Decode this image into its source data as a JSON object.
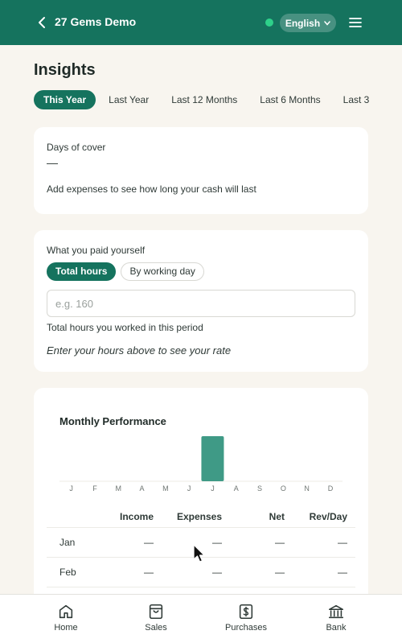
{
  "header": {
    "title": "27 Gems Demo",
    "language": "English"
  },
  "page": {
    "title": "Insights"
  },
  "tabs": [
    {
      "label": "This Year",
      "active": true
    },
    {
      "label": "Last Year",
      "active": false
    },
    {
      "label": "Last 12 Months",
      "active": false
    },
    {
      "label": "Last 6 Months",
      "active": false
    },
    {
      "label": "Last 3",
      "active": false
    }
  ],
  "days_of_cover": {
    "label": "Days of cover",
    "value": "—",
    "hint": "Add expenses to see how long your cash will last"
  },
  "paid_yourself": {
    "label": "What you paid yourself",
    "toggle": [
      "Total hours",
      "By working day"
    ],
    "input_placeholder": "e.g. 160",
    "input_hint": "Total hours you worked in this period",
    "prompt": "Enter your hours above to see your rate"
  },
  "monthly": {
    "title": "Monthly Performance",
    "columns": [
      "",
      "Income",
      "Expenses",
      "Net",
      "Rev/Day"
    ],
    "rows": [
      [
        "Jan",
        "—",
        "—",
        "—",
        "—"
      ],
      [
        "Feb",
        "—",
        "—",
        "—",
        "—"
      ]
    ]
  },
  "chart_data": {
    "type": "bar",
    "categories": [
      "J",
      "F",
      "M",
      "A",
      "M",
      "J",
      "J",
      "A",
      "S",
      "O",
      "N",
      "D"
    ],
    "values": [
      0,
      0,
      0,
      0,
      0,
      0,
      1,
      0,
      0,
      0,
      0,
      0
    ],
    "title": "Monthly Performance",
    "bar_color": "#3f9a86",
    "ylim": [
      0,
      1
    ]
  },
  "nav": [
    {
      "label": "Home",
      "icon": "home-icon"
    },
    {
      "label": "Sales",
      "icon": "bag-icon"
    },
    {
      "label": "Purchases",
      "icon": "receipt-dollar-icon"
    },
    {
      "label": "Bank",
      "icon": "bank-icon"
    }
  ],
  "colors": {
    "brand": "#15735e",
    "status_online": "#2ed18a"
  }
}
